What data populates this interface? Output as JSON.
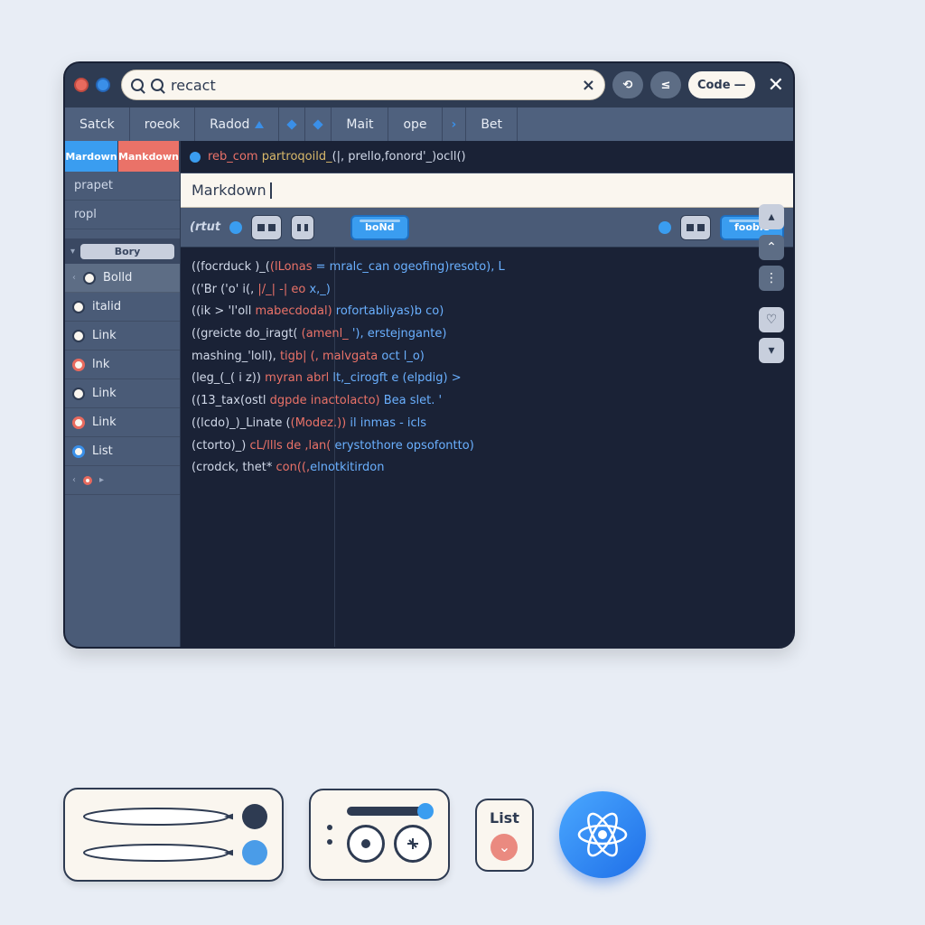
{
  "search": {
    "value": "recact"
  },
  "header": {
    "code_label": "Code"
  },
  "tabs": [
    "Satck",
    "roeok",
    "Radod",
    "Mait",
    "ope",
    "Bet"
  ],
  "subtabs": [
    "Mardown",
    "Mankdown"
  ],
  "side_items": [
    "prapet",
    "ropl"
  ],
  "outline_header": "Bory",
  "outline": [
    "Bolld",
    "italid",
    "Link",
    "lnk",
    "Link",
    "Link",
    "List"
  ],
  "status_line": {
    "a": "reb_com ",
    "b": "partroqoild_",
    "c": "(|, prello,fonord'_)ocll()"
  },
  "markdown_label": "Markdown",
  "toolbar": {
    "label": "(rtut",
    "bold": "boNd",
    "code": "fooble"
  },
  "code": [
    {
      "p": "((focrduck )_(",
      "k": "(lLonas ",
      "y": "= mralc_can ogeofing)resoto), L"
    },
    {
      "p": "(('Br ('o' i(, ",
      "k": "|/_| -| eo ",
      "y": "x,_)"
    },
    {
      "p": "((ik > 'l'oll ",
      "k": "mabecdodal) ",
      "y": "rofortabliyas)b co)"
    },
    {
      "p": "((greicte do_iragt( ",
      "k": "(amenl_ ",
      "y": "'), erstejngante)"
    },
    {
      "p": "  mashing_'loll), ",
      "k": "tigb| (, malvgata ",
      "y": "oct l_o)"
    },
    {
      "p": "(leg_(_( i z)) ",
      "k": "myran abrl ",
      "y": "lt,_cirogft e (elpdig) >"
    },
    {
      "p": "((13_tax(ostl ",
      "k": "dgpde inactolacto) ",
      "y": "Bea slet.  '"
    },
    {
      "p": "((lcdo)_)_Linate (",
      "k": "(Modez.)) ",
      "y": "il inmas - icls"
    },
    {
      "p": "(ctorto)_) ",
      "k": "cL/llls de ,lan( ",
      "y": "erystothore opsofontto)"
    },
    {
      "p": "(crodck, thet* ",
      "k": "con((,",
      "y": "elnotkitirdon"
    }
  ],
  "bottom": {
    "list_label": "List"
  }
}
